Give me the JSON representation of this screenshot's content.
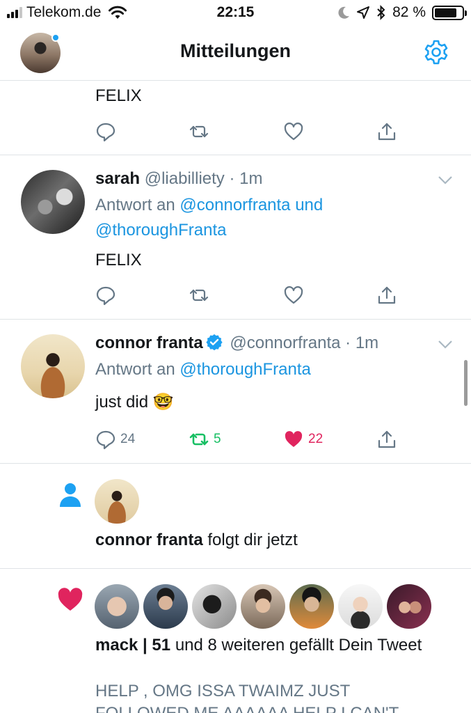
{
  "status_bar": {
    "carrier": "Telekom.de",
    "time": "22:15",
    "battery": "82 %",
    "battery_level": 0.82
  },
  "header": {
    "title": "Mitteilungen",
    "settings_icon": "gear-icon",
    "has_unread_dot": true
  },
  "colors": {
    "accent": "#1da1f2",
    "mention": "#1b95e0",
    "retweet_active": "#17bf63",
    "like_active": "#e0245e",
    "muted": "#657786"
  },
  "tweet_top_partial": {
    "text": "FELIX"
  },
  "tweet_sarah": {
    "name": "sarah",
    "handle": "@liabilliety",
    "time": "· 1m",
    "reply_prefix": "Antwort an",
    "mention_1": "@connorfranta",
    "joiner": "und",
    "mention_2": "@thoroughFranta",
    "text": "FELIX"
  },
  "tweet_connor": {
    "name": "connor franta",
    "verified": true,
    "handle": "@connorfranta",
    "time": "· 1m",
    "reply_prefix": "Antwort an",
    "mention": "@thoroughFranta",
    "text": "just did 🤓",
    "replies": "24",
    "retweets": "5",
    "likes": "22"
  },
  "follow_notice": {
    "name": "connor franta",
    "text": "folgt dir jetzt",
    "icon": "person-icon"
  },
  "like_notice": {
    "icon": "heart-icon",
    "user": "mack | 51",
    "rest": "und 8 weiteren gefällt Dein Tweet",
    "quoted_line_1": "HELP , OMG ISSA TWAIMZ JUST",
    "quoted_line_2": "FOLLOWED ME AAAAAA HELP I CAN'T"
  }
}
